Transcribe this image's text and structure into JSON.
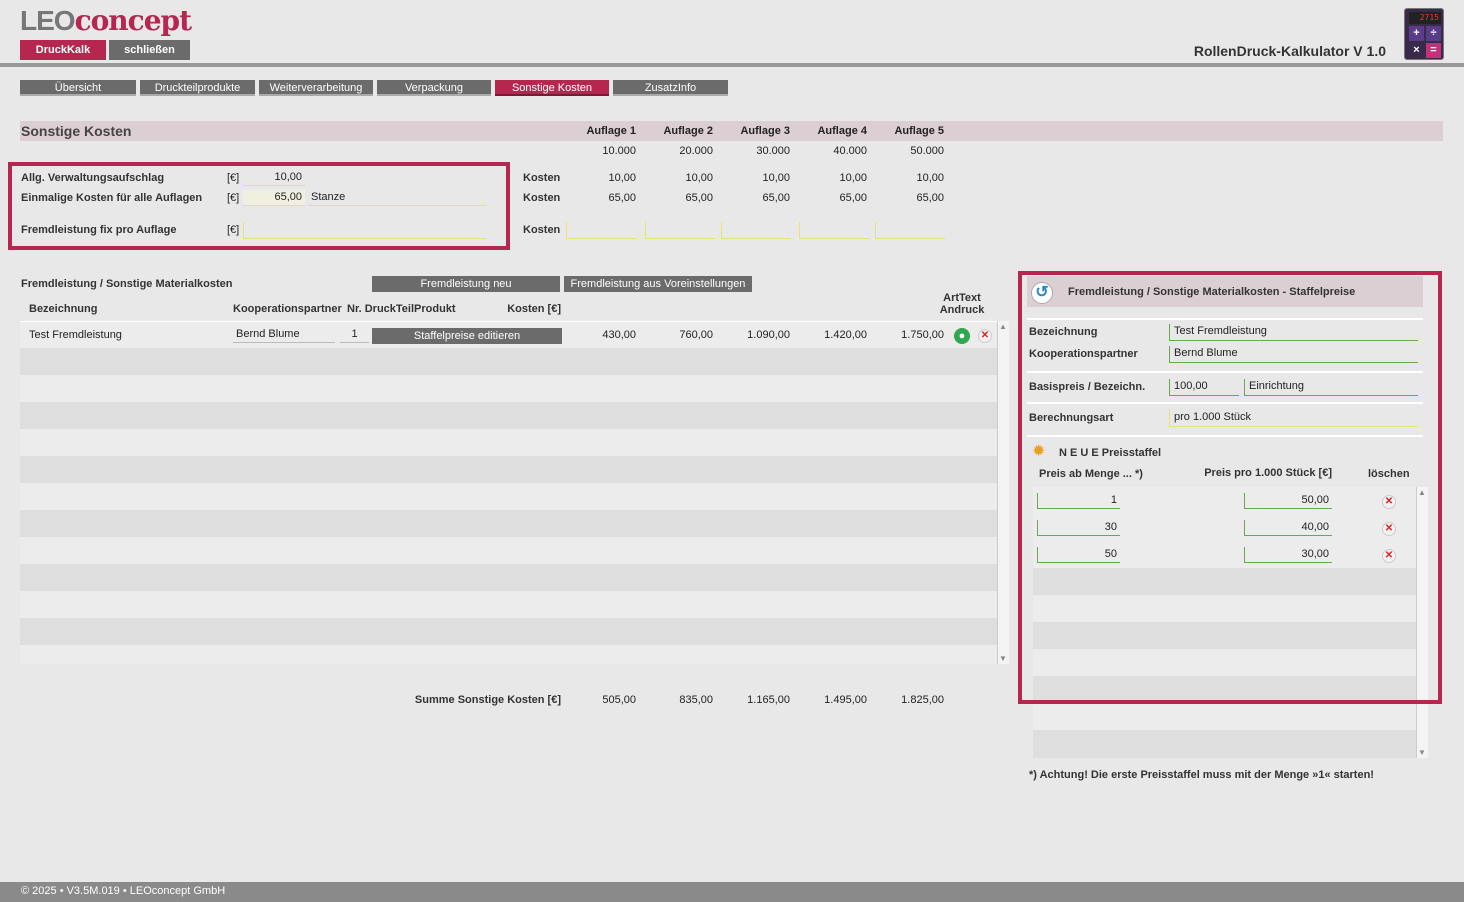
{
  "app": {
    "logo_leo": "LEO",
    "logo_concept": "concept",
    "title": "RollenDruck-Kalkulator V 1.0",
    "calc_display": "2715",
    "btn_druckkalk": "DruckKalk",
    "btn_schliessen": "schließen",
    "accent": "#b5274f"
  },
  "tabs": [
    "Übersicht",
    "Druckteilprodukte",
    "Weiterverarbeitung",
    "Verpackung",
    "Sonstige Kosten",
    "ZusatzInfo"
  ],
  "section": {
    "title": "Sonstige Kosten",
    "auflagen_headers": [
      "Auflage 1",
      "Auflage 2",
      "Auflage 3",
      "Auflage 4",
      "Auflage 5"
    ],
    "auflagen_values": [
      "10.000",
      "20.000",
      "30.000",
      "40.000",
      "50.000"
    ]
  },
  "costs": {
    "row1_label": "Allg. Verwaltungsaufschlag",
    "row1_unit": "[€]",
    "row1_value": "10,00",
    "row1_kosten": "Kosten",
    "row1_values": [
      "10,00",
      "10,00",
      "10,00",
      "10,00",
      "10,00"
    ],
    "row2_label": "Einmalige Kosten für alle Auflagen",
    "row2_unit": "[€]",
    "row2_value": "65,00",
    "row2_text": "Stanze",
    "row2_kosten": "Kosten",
    "row2_values": [
      "65,00",
      "65,00",
      "65,00",
      "65,00",
      "65,00"
    ],
    "row3_label": "Fremdleistung fix pro Auflage",
    "row3_unit": "[€]",
    "row3_kosten": "Kosten"
  },
  "fremd": {
    "title": "Fremdleistung /  Sonstige Materialkosten",
    "btn_neu": "Fremdleistung neu",
    "btn_voreinst": "Fremdleistung aus Voreinstellungen",
    "col_bezeichnung": "Bezeichnung",
    "col_partner": "Kooperationspartner",
    "col_nr": "Nr. DruckTeilProdukt",
    "col_kosten": "Kosten [€]",
    "col_arttext_1": "ArtText",
    "col_arttext_2": "Andruck",
    "row": {
      "bezeichnung": "Test Fremdleistung",
      "partner": "Bernd Blume",
      "nr": "1",
      "btn_staffel": "Staffelpreise editieren",
      "values": [
        "430,00",
        "760,00",
        "1.090,00",
        "1.420,00",
        "1.750,00"
      ]
    },
    "summe_label": "Summe Sonstige Kosten [€]",
    "summe_values": [
      "505,00",
      "835,00",
      "1.165,00",
      "1.495,00",
      "1.825,00"
    ]
  },
  "panel": {
    "title": "Fremdleistung /  Sonstige Materialkosten - Staffelpreise",
    "lbl_bezeichnung": "Bezeichnung",
    "val_bezeichnung": "Test Fremdleistung",
    "lbl_partner": "Kooperationspartner",
    "val_partner": "Bernd Blume",
    "lbl_basis": "Basispreis / Bezeichn.",
    "val_basis": "100,00",
    "val_basis_text": "Einrichtung",
    "lbl_berechnung": "Berechnungsart",
    "val_berechnung": "pro 1.000 Stück",
    "neue_label": "N E U E  Preisstaffel",
    "col_menge": "Preis ab Menge ... *)",
    "col_preis": "Preis pro 1.000 Stück [€]",
    "col_loeschen": "löschen",
    "staffeln": [
      {
        "menge": "1",
        "preis": "50,00"
      },
      {
        "menge": "30",
        "preis": "40,00"
      },
      {
        "menge": "50",
        "preis": "30,00"
      }
    ],
    "note": "*) Achtung! Die erste Preisstaffel muss mit der Menge »1« starten!"
  },
  "footer": "© 2025 • V3.5M.019 • LEOconcept GmbH"
}
